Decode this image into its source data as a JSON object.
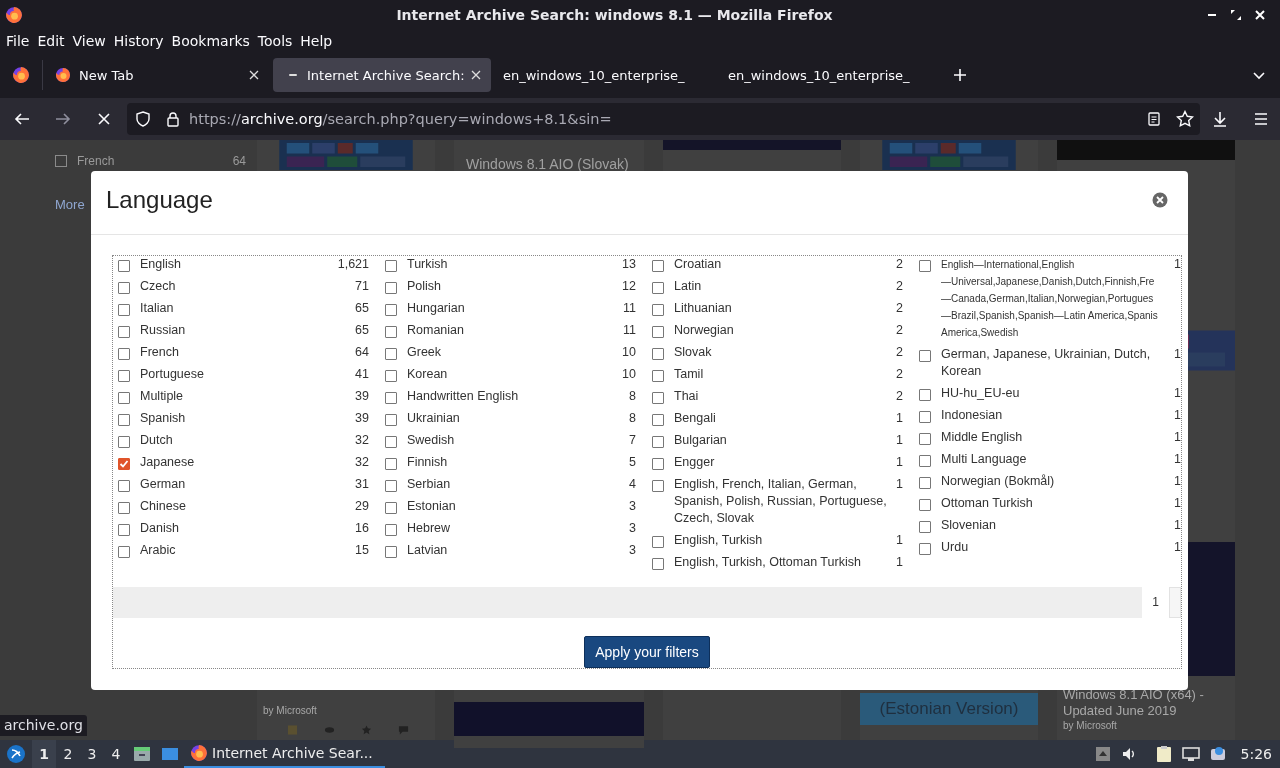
{
  "window": {
    "title": "Internet Archive Search: windows 8.1 — Mozilla Firefox"
  },
  "menu_bar": [
    "File",
    "Edit",
    "View",
    "History",
    "Bookmarks",
    "Tools",
    "Help"
  ],
  "tabs": [
    {
      "title": "New Tab",
      "selected": false
    },
    {
      "title": "Internet Archive Search:",
      "selected": true
    },
    {
      "title": "en_windows_10_enterprise_",
      "selected": false
    },
    {
      "title": "en_windows_10_enterprise_",
      "selected": false
    }
  ],
  "address_bar": {
    "scheme": "https://",
    "domain": "archive.org",
    "rest": "/search.php?query=windows+8.1&sin=",
    "loading": true
  },
  "page": {
    "sidebar": [
      {
        "label": "French",
        "count": "64",
        "checked": false
      }
    ],
    "more_link": "More",
    "results": [
      {
        "kind": "thumb",
        "bottom_lines": [
          "by Microsoft"
        ],
        "actions": true
      },
      {
        "kind": "title",
        "title": "Windows 8.1 AIO (Slovak)"
      },
      {
        "kind": "bar"
      },
      {
        "kind": "thumb",
        "bottom_tile": "(Estonian Version)"
      },
      {
        "kind": "dark",
        "bottom_lines": [
          "Windows 8.1 AIO (x64) -",
          "Updated June 2019",
          "by Microsoft"
        ]
      }
    ]
  },
  "modal": {
    "title": "Language",
    "columns": [
      [
        {
          "label": "English",
          "count": "1,621",
          "checked": false
        },
        {
          "label": "Czech",
          "count": "71",
          "checked": false
        },
        {
          "label": "Italian",
          "count": "65",
          "checked": false
        },
        {
          "label": "Russian",
          "count": "65",
          "checked": false
        },
        {
          "label": "French",
          "count": "64",
          "checked": false
        },
        {
          "label": "Portuguese",
          "count": "41",
          "checked": false
        },
        {
          "label": "Multiple",
          "count": "39",
          "checked": false
        },
        {
          "label": "Spanish",
          "count": "39",
          "checked": false
        },
        {
          "label": "Dutch",
          "count": "32",
          "checked": false
        },
        {
          "label": "Japanese",
          "count": "32",
          "checked": true
        },
        {
          "label": "German",
          "count": "31",
          "checked": false
        },
        {
          "label": "Chinese",
          "count": "29",
          "checked": false
        },
        {
          "label": "Danish",
          "count": "16",
          "checked": false
        },
        {
          "label": "Arabic",
          "count": "15",
          "checked": false
        }
      ],
      [
        {
          "label": "Turkish",
          "count": "13",
          "checked": false
        },
        {
          "label": "Polish",
          "count": "12",
          "checked": false
        },
        {
          "label": "Hungarian",
          "count": "11",
          "checked": false
        },
        {
          "label": "Romanian",
          "count": "11",
          "checked": false
        },
        {
          "label": "Greek",
          "count": "10",
          "checked": false
        },
        {
          "label": "Korean",
          "count": "10",
          "checked": false
        },
        {
          "label": "Handwritten English",
          "count": "8",
          "checked": false
        },
        {
          "label": "Ukrainian",
          "count": "8",
          "checked": false
        },
        {
          "label": "Swedish",
          "count": "7",
          "checked": false
        },
        {
          "label": "Finnish",
          "count": "5",
          "checked": false
        },
        {
          "label": "Serbian",
          "count": "4",
          "checked": false
        },
        {
          "label": "Estonian",
          "count": "3",
          "checked": false
        },
        {
          "label": "Hebrew",
          "count": "3",
          "checked": false
        },
        {
          "label": "Latvian",
          "count": "3",
          "checked": false
        }
      ],
      [
        {
          "label": "Croatian",
          "count": "2",
          "checked": false
        },
        {
          "label": "Latin",
          "count": "2",
          "checked": false
        },
        {
          "label": "Lithuanian",
          "count": "2",
          "checked": false
        },
        {
          "label": "Norwegian",
          "count": "2",
          "checked": false
        },
        {
          "label": "Slovak",
          "count": "2",
          "checked": false
        },
        {
          "label": "Tamil",
          "count": "2",
          "checked": false
        },
        {
          "label": "Thai",
          "count": "2",
          "checked": false
        },
        {
          "label": "Bengali",
          "count": "1",
          "checked": false
        },
        {
          "label": "Bulgarian",
          "count": "1",
          "checked": false
        },
        {
          "label": "Engger",
          "count": "1",
          "checked": false
        },
        {
          "label": "English, French, Italian, German, Spanish, Polish, Russian, Portuguese, Czech, Slovak",
          "count": "1",
          "checked": false
        },
        {
          "label": "English, Turkish",
          "count": "1",
          "checked": false
        },
        {
          "label": "English, Turkish, Ottoman Turkish",
          "count": "1",
          "checked": false
        }
      ],
      [
        {
          "label_lines": [
            "English—International,English",
            "—Universal,Japanese,Danish,Dutch,Finnish,Fre",
            "—Canada,German,Italian,Norwegian,Portugues",
            "—Brazil,Spanish,Spanish—Latin America,Spanis",
            "America,Swedish"
          ],
          "count": "1",
          "checked": false
        },
        {
          "label": "German, Japanese, Ukrainian, Dutch, Korean",
          "count": "1",
          "checked": false
        },
        {
          "label": "HU-hu_EU-eu",
          "count": "1",
          "checked": false
        },
        {
          "label": "Indonesian",
          "count": "1",
          "checked": false
        },
        {
          "label": "Middle English",
          "count": "1",
          "checked": false
        },
        {
          "label": "Multi Language",
          "count": "1",
          "checked": false
        },
        {
          "label": "Norwegian (Bokmål)",
          "count": "1",
          "checked": false
        },
        {
          "label": "Ottoman Turkish",
          "count": "1",
          "checked": false
        },
        {
          "label": "Slovenian",
          "count": "1",
          "checked": false
        },
        {
          "label": "Urdu",
          "count": "1",
          "checked": false
        }
      ]
    ],
    "pager": {
      "page": "1"
    },
    "apply_button": "Apply your filters"
  },
  "status_link": "archive.org",
  "taskbar": {
    "workspaces": [
      {
        "label": "1",
        "selected": true
      },
      {
        "label": "2",
        "selected": false
      },
      {
        "label": "3",
        "selected": false
      },
      {
        "label": "4",
        "selected": false
      }
    ],
    "task": {
      "title": "Internet Archive Sear...",
      "selected": true
    },
    "clock": "5:26"
  }
}
